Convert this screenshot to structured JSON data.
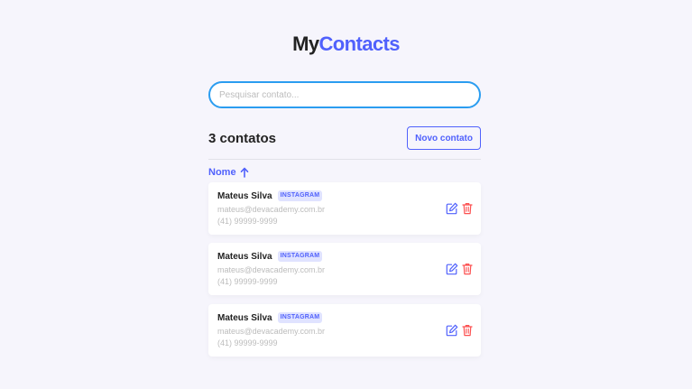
{
  "app": {
    "logo_my": "My",
    "logo_contacts": "Contacts"
  },
  "search": {
    "placeholder": "Pesquisar contato...",
    "value": ""
  },
  "header": {
    "count_label": "3 contatos",
    "new_button_label": "Novo contato"
  },
  "sort": {
    "label": "Nome",
    "direction_icon": "arrow-up-icon"
  },
  "contacts": [
    {
      "name": "Mateus Silva",
      "category": "INSTAGRAM",
      "email": "mateus@devacademy.com.br",
      "phone": "(41) 99999-9999"
    },
    {
      "name": "Mateus Silva",
      "category": "INSTAGRAM",
      "email": "mateus@devacademy.com.br",
      "phone": "(41) 99999-9999"
    },
    {
      "name": "Mateus Silva",
      "category": "INSTAGRAM",
      "email": "mateus@devacademy.com.br",
      "phone": "(41) 99999-9999"
    }
  ],
  "icons": {
    "edit": "edit-icon",
    "delete": "trash-icon"
  },
  "colors": {
    "background": "#f6f5fc",
    "primary": "#5061fc",
    "search_border": "#2b9df0",
    "danger": "#fc5050",
    "tag_background": "#e0e3ff",
    "muted_text": "#bcbcbc"
  }
}
